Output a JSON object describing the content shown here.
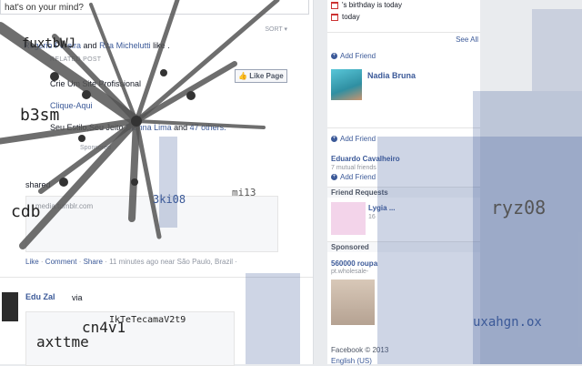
{
  "feed": {
    "status_placeholder": "hat's on your mind?",
    "sort_label": "SORT ▾",
    "like_line": {
      "names_a": "Rogerio Pereira",
      "and_1": " and ",
      "names_b": "Rita Michelutti",
      "suffix": " like ."
    },
    "related_label": "RELATED POST",
    "related_title": "Crie Um Site Profissional",
    "related_link": "Clique-Aqui",
    "like_page_label": "Like Page",
    "estilo_line": {
      "prefix": "Seu Estilo,Seu Jeito.",
      "name": "Dianna Lima",
      "and": " and ",
      "others": "47 others."
    },
    "sponsored_tiny": "Sponsored",
    "shared_label": "shared",
    "share_url": "media.tumblr.com",
    "actions": {
      "like": "Like",
      "comment": "Comment",
      "share": "Share",
      "meta": " · 11 minutes ago near São Paulo, Brazil · "
    },
    "post2": {
      "author": "Edu Zal",
      "via": "via"
    }
  },
  "rail": {
    "birthday": "'s birthday is today",
    "today": "today",
    "see_all": "See All",
    "add_friend": "Add Friend",
    "nadia": "Nadia Bruna",
    "eduardo": "Eduardo Cavalheiro",
    "mutual": "7 mutual friends",
    "friend_requests": "Friend Requests",
    "request_name": "Lygia ...",
    "request_sub": "16",
    "sponsored": "Sponsored",
    "ad_title": "560000 roupa",
    "ad_url": "pt.wholesale-",
    "footer1": "Facebook © 2013",
    "footer2": "English (US)"
  },
  "glitch_text": {
    "g1": "fuxtbWJ",
    "g2": "b3sm",
    "g3": "cdb",
    "g4": "3ki08",
    "g5": "mi13",
    "g6": "cn4v1",
    "g7": "axttme",
    "g8": "IkTeTecamaV2t9",
    "g9": "ryz08",
    "g10": "uxahgn.ox"
  },
  "colors": {
    "fb_blue": "#3b5998",
    "background": "#e9ebee"
  }
}
